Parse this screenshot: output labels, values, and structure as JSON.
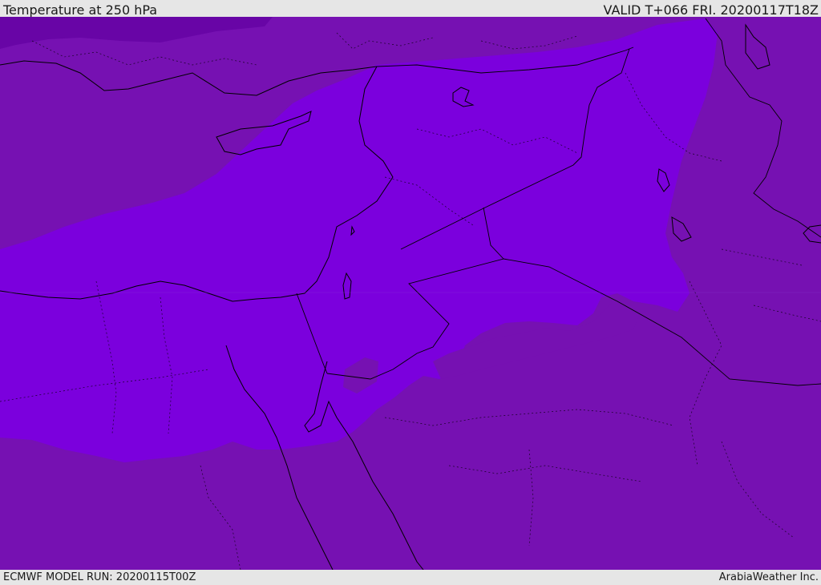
{
  "header": {
    "title": "Temperature at 250 hPa",
    "valid": "VALID T+066 FRI. 20200117T18Z"
  },
  "footer": {
    "model_run": "ECMWF MODEL RUN: 20200115T00Z",
    "brand": "ArabiaWeather Inc."
  },
  "map": {
    "field": "temperature",
    "level": "250 hPa",
    "colors": {
      "background": "#7611b2",
      "warm_band": "#7b00dd",
      "cold_core": "#6805a6",
      "coastline": "#000000",
      "borders": "#000000"
    }
  }
}
